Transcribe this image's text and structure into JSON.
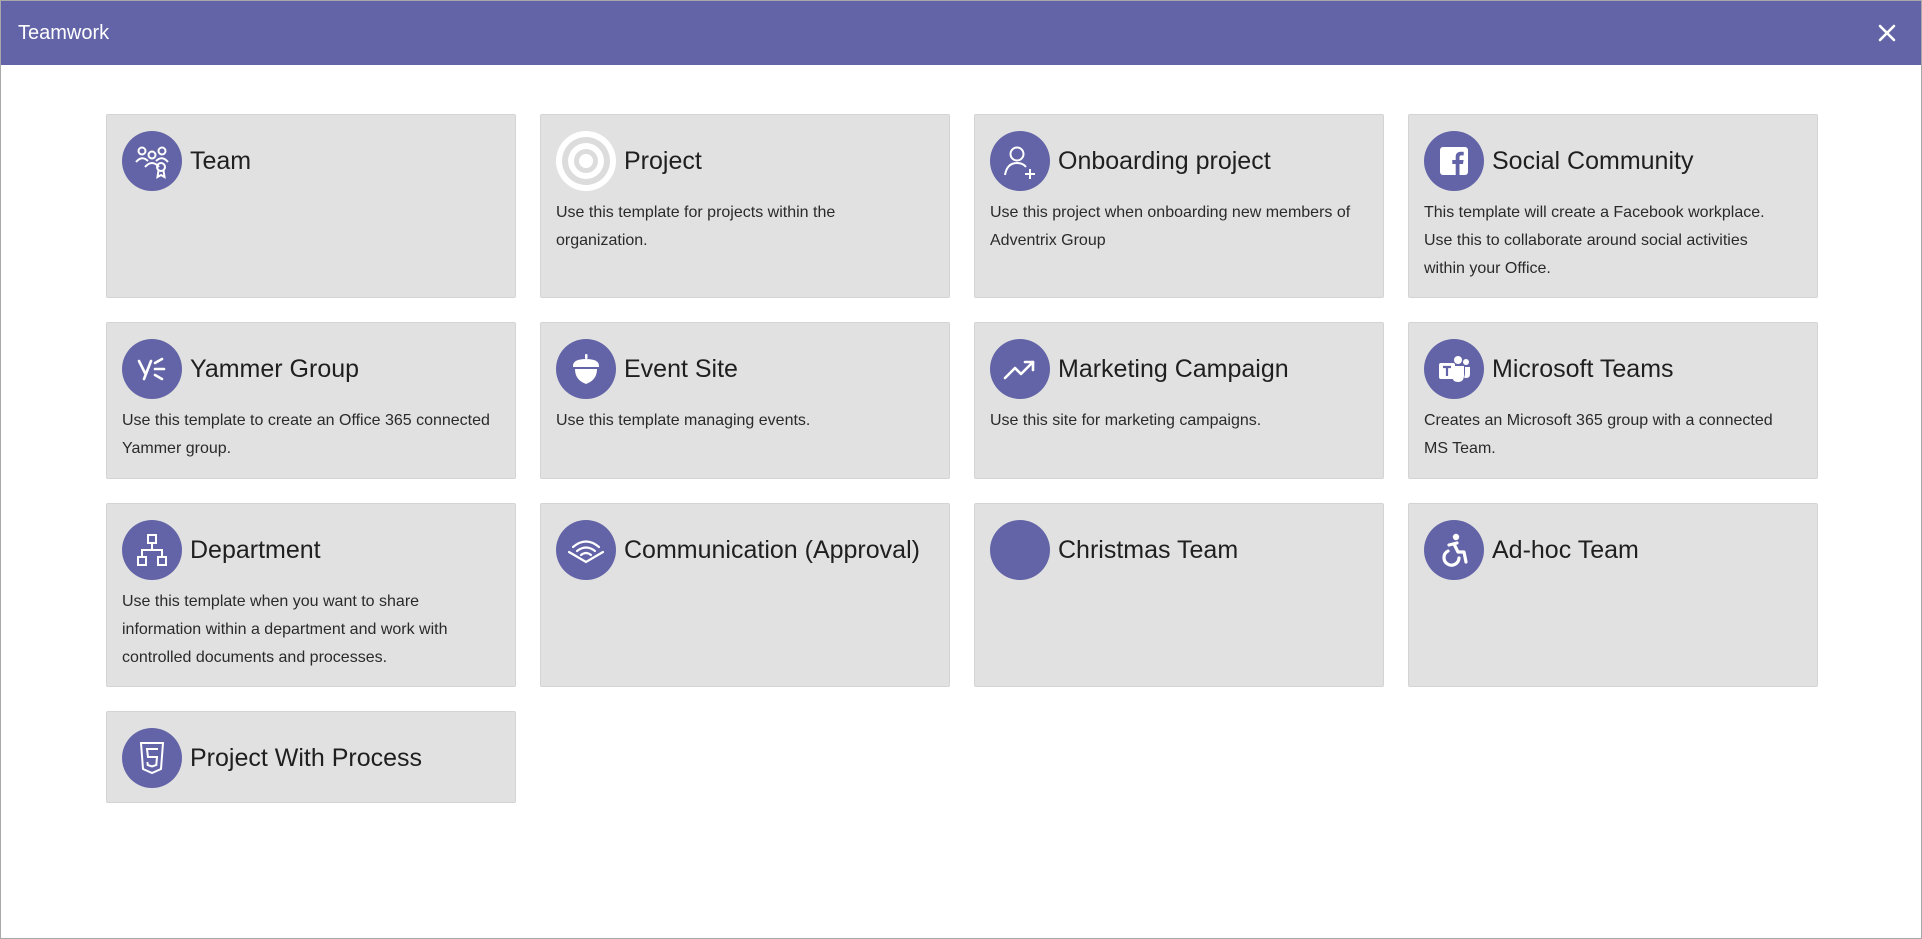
{
  "window": {
    "title": "Teamwork",
    "accent_color": "#6264a7"
  },
  "templates": [
    {
      "title": "Team",
      "description": "",
      "icon": "team-icon"
    },
    {
      "title": "Project",
      "description": "Use this template for projects within the organization.",
      "icon": "target-icon"
    },
    {
      "title": "Onboarding project",
      "description": "Use this project when onboarding new members of Adventrix Group",
      "icon": "add-user-icon"
    },
    {
      "title": "Social Community",
      "description": "This template will create a Facebook workplace. Use this to collaborate around social activities within your Office.",
      "icon": "facebook-icon"
    },
    {
      "title": "Yammer Group",
      "description": "Use this template to create an Office 365 connected Yammer group.",
      "icon": "yammer-icon"
    },
    {
      "title": "Event Site",
      "description": "Use this template managing events.",
      "icon": "acorn-icon"
    },
    {
      "title": "Marketing Campaign",
      "description": "Use this site for marketing campaigns.",
      "icon": "trending-up-icon"
    },
    {
      "title": "Microsoft Teams",
      "description": "Creates an Microsoft 365 group with a connected MS Team.",
      "icon": "teams-icon"
    },
    {
      "title": "Department",
      "description": "Use this template when you want to share information within a department and work with controlled documents and processes.",
      "icon": "org-chart-icon"
    },
    {
      "title": "Communication (Approval)",
      "description": "",
      "icon": "wifi-book-icon"
    },
    {
      "title": "Christmas Team",
      "description": "",
      "icon": "blank-circle-icon"
    },
    {
      "title": "Ad-hoc Team",
      "description": "",
      "icon": "accessibility-icon"
    },
    {
      "title": "Project With Process",
      "description": "",
      "icon": "html5-icon"
    }
  ]
}
